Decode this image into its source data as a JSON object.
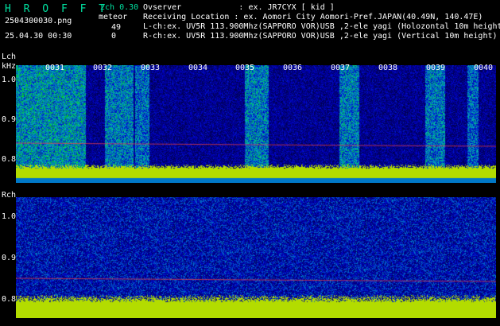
{
  "header": {
    "title": "H R O F F T",
    "filename": "2504300030.png",
    "datetime": "25.04.30 00:30",
    "channel_info": "2ch 0.30",
    "meteor_label": "meteor",
    "meteor_count_l": "49",
    "meteor_count_r": "0"
  },
  "info": {
    "observer": "Ovserver            : ex. JR7CYX [ kid ]",
    "location": "Receiving Location : ex. Aomori City Aomori-Pref.JAPAN(40.49N, 140.47E)",
    "lch": "L-ch:ex. UV5R 113.900Mhz(SAPPORO VOR)USB ,2-ele yagi (Holozontal 10m height)",
    "rch": "R-ch:ex. UV5R 113.900Mhz(SAPPORO VOR)USB ,2-ele yagi (Vertical 10m height)"
  },
  "lch_panel": {
    "label": "Lch",
    "unit": "kHz",
    "yticks": [
      "1.0",
      "0.9",
      "0.8"
    ],
    "minute_labels": [
      "0031",
      "0032",
      "0033",
      "0034",
      "0035",
      "0036",
      "0037",
      "0038",
      "0039",
      "0040"
    ]
  },
  "rch_panel": {
    "label": "Rch",
    "yticks": [
      "1.0",
      "0.9",
      "0.8"
    ]
  },
  "colors": {
    "text": "#ffffff",
    "title": "#00e0a0",
    "spectrum_low": "#000080",
    "spectrum_mid": "#00c0c0",
    "spectrum_high": "#ffff00",
    "carrier": "#ff4040"
  }
}
